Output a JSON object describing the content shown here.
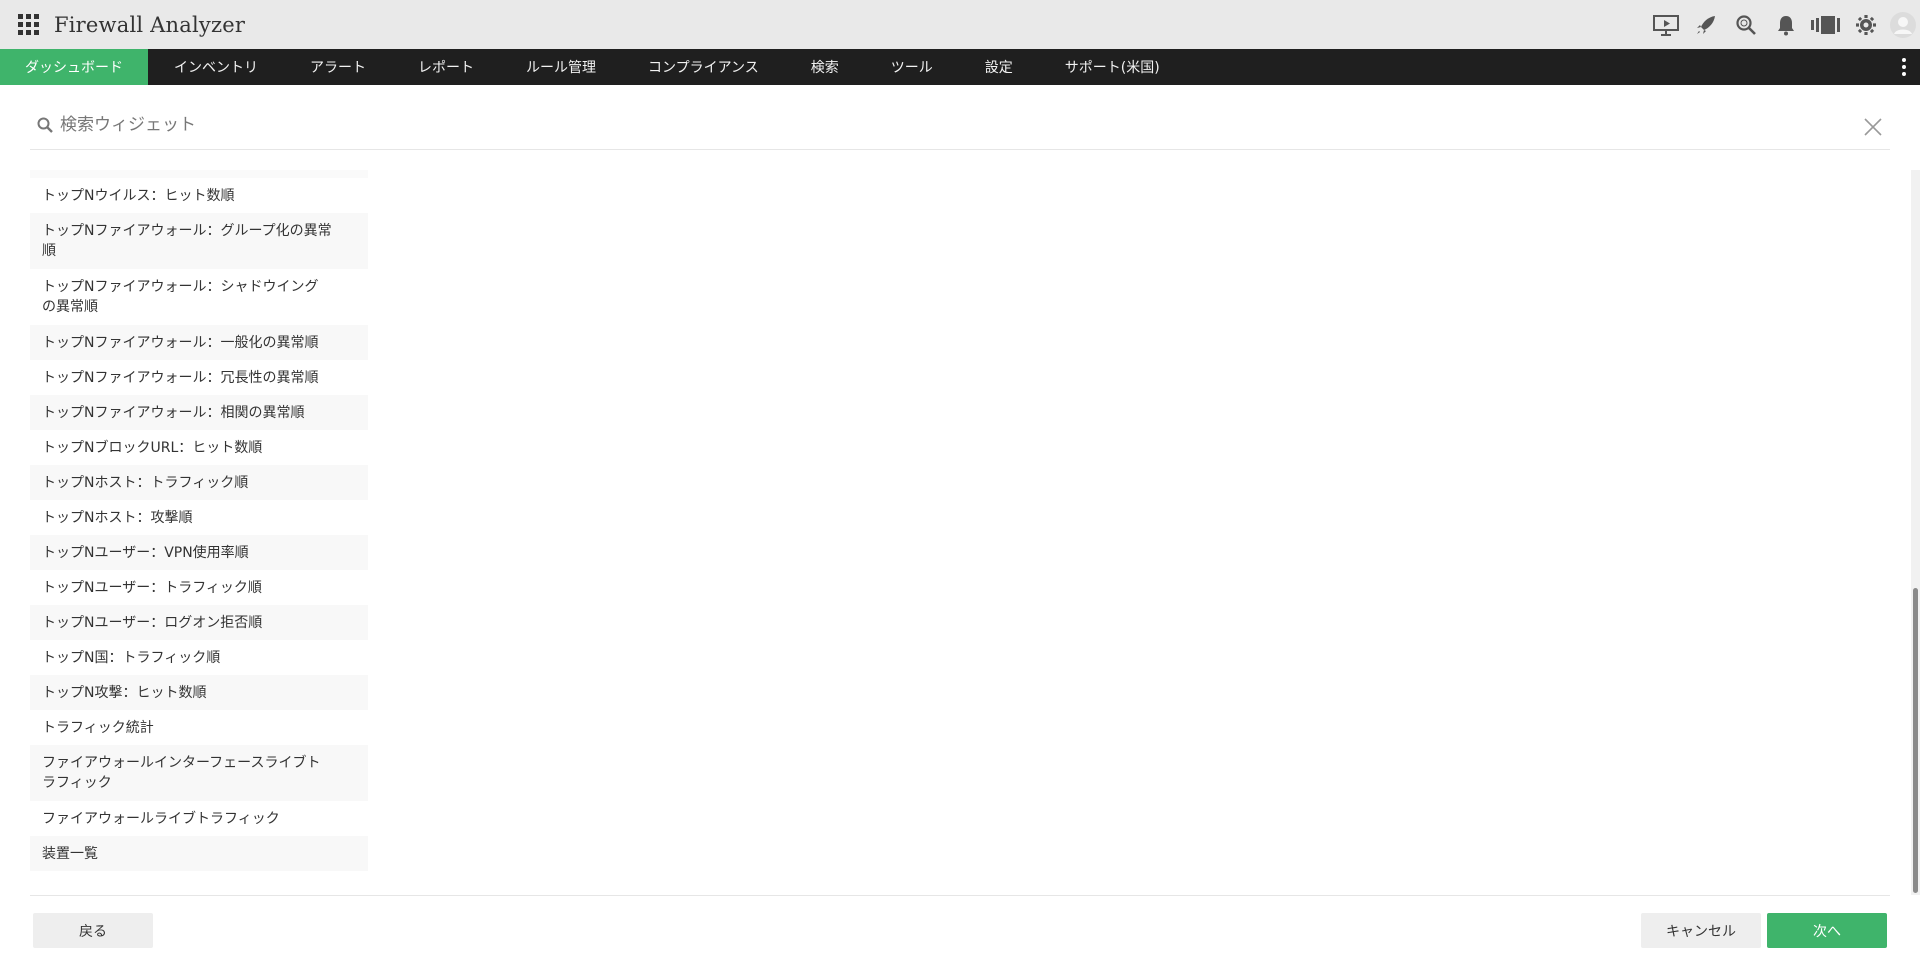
{
  "app": {
    "title": "Firewall Analyzer",
    "accent_color": "#3fb46b"
  },
  "header_icons": [
    "presentation-icon",
    "rocket-icon",
    "search-icon",
    "bell-icon",
    "device-icon",
    "gear-icon",
    "user-avatar-icon"
  ],
  "nav": {
    "items": [
      {
        "label": "ダッシュボード",
        "active": true
      },
      {
        "label": "インベントリ",
        "active": false
      },
      {
        "label": "アラート",
        "active": false
      },
      {
        "label": "レポート",
        "active": false
      },
      {
        "label": "ルール管理",
        "active": false
      },
      {
        "label": "コンプライアンス",
        "active": false
      },
      {
        "label": "検索",
        "active": false
      },
      {
        "label": "ツール",
        "active": false
      },
      {
        "label": "設定",
        "active": false
      },
      {
        "label": "サポート(米国)",
        "active": false
      }
    ]
  },
  "search": {
    "placeholder": "検索ウィジェット"
  },
  "widgets": [
    "トップNウイルス：ヒット数順",
    "トップNファイアウォール：グループ化の異常順",
    "トップNファイアウォール：シャドウイングの異常順",
    "トップNファイアウォール：一般化の異常順",
    "トップNファイアウォール：冗長性の異常順",
    "トップNファイアウォール：相関の異常順",
    "トップNブロックURL：ヒット数順",
    "トップNホスト：トラフィック順",
    "トップNホスト：攻撃順",
    "トップNユーザー：VPN使用率順",
    "トップNユーザー：トラフィック順",
    "トップNユーザー：ログオン拒否順",
    "トップN国：トラフィック順",
    "トップN攻撃：ヒット数順",
    "トラフィック統計",
    "ファイアウォールインターフェースライブトラフィック",
    "ファイアウォールライブトラフィック",
    "装置一覧"
  ],
  "footer": {
    "back_label": "戻る",
    "cancel_label": "キャンセル",
    "next_label": "次へ"
  }
}
